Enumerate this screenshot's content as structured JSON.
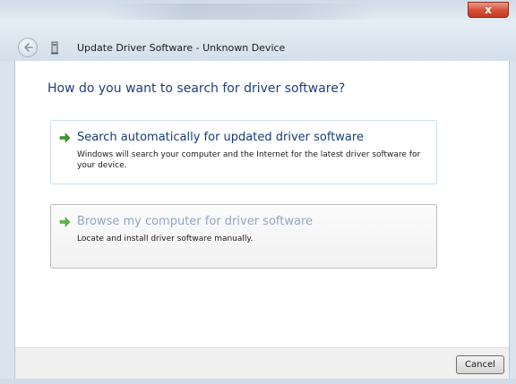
{
  "window": {
    "title": "Update Driver Software - Unknown Device",
    "close_label": "x"
  },
  "icons": {
    "back": "back-arrow-icon",
    "device": "device-icon",
    "close": "close-icon",
    "option_arrow": "green-arrow-icon"
  },
  "content": {
    "heading": "How do you want to search for driver software?",
    "options": [
      {
        "title": "Search automatically for updated driver software",
        "description": "Windows will search your computer and the Internet for the latest driver software for your device."
      },
      {
        "title": "Browse my computer for driver software",
        "description": "Locate and install driver software manually."
      }
    ]
  },
  "footer": {
    "cancel_label": "Cancel"
  },
  "colors": {
    "heading": "#1f3f7a",
    "option_title": "#143c7a",
    "option_title_muted": "#8fa6c8",
    "arrow_green": "#3a9a2a",
    "close_red": "#c8402a"
  }
}
